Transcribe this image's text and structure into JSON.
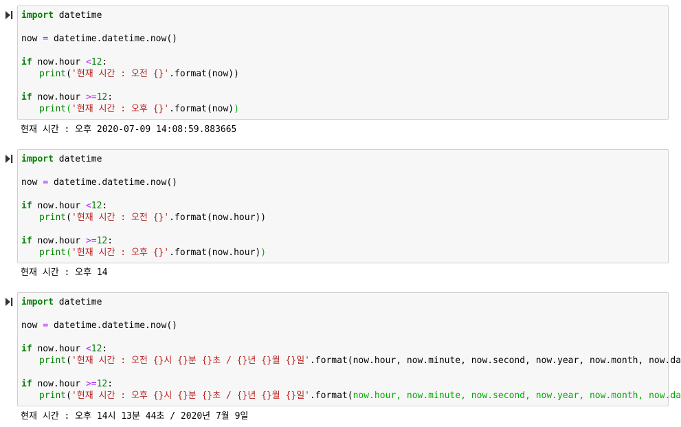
{
  "cells": [
    {
      "run_button": "run-icon",
      "code": {
        "l1": {
          "kw": "import",
          "rest": " datetime"
        },
        "l2": {
          "a": "now ",
          "op": "=",
          "b": " datetime.datetime.now()"
        },
        "l3": {
          "kw": "if",
          "a": " now.hour ",
          "op": "<",
          "num": "12",
          "b": ":"
        },
        "l4": {
          "fn": "print",
          "p": "(",
          "str": "'현재 시간 : 오전 {}'",
          "rest": ".format(now))"
        },
        "l5": {
          "kw": "if",
          "a": " now.hour ",
          "op": ">=",
          "num": "12",
          "b": ":"
        },
        "l6": {
          "fn": "print",
          "p": "(",
          "str": "'현재 시간 : 오후 {}'",
          "rest": ".format(now)",
          "close": ")"
        }
      },
      "output": "현재 시간 : 오후 2020-07-09 14:08:59.883665"
    },
    {
      "run_button": "run-icon",
      "code": {
        "l1": {
          "kw": "import",
          "rest": " datetime"
        },
        "l2": {
          "a": "now ",
          "op": "=",
          "b": " datetime.datetime.now()"
        },
        "l3": {
          "kw": "if",
          "a": " now.hour ",
          "op": "<",
          "num": "12",
          "b": ":"
        },
        "l4": {
          "fn": "print",
          "p": "(",
          "str": "'현재 시간 : 오전 {}'",
          "rest": ".format(now.hour))"
        },
        "l5": {
          "kw": "if",
          "a": " now.hour ",
          "op": ">=",
          "num": "12",
          "b": ":"
        },
        "l6": {
          "fn": "print",
          "p": "(",
          "str": "'현재 시간 : 오후 {}'",
          "rest": ".format(now.hour)",
          "close": ")"
        }
      },
      "output": "현재 시간 : 오후 14"
    },
    {
      "run_button": "run-icon",
      "code": {
        "l1": {
          "kw": "import",
          "rest": " datetime"
        },
        "l2": {
          "a": "now ",
          "op": "=",
          "b": " datetime.datetime.now()"
        },
        "l3": {
          "kw": "if",
          "a": " now.hour ",
          "op": "<",
          "num": "12",
          "b": ":"
        },
        "l4": {
          "fn": "print",
          "p": "(",
          "str": "'현재 시간 : 오전 {}시 {}분 {}초 / {}년 {}월 {}일'",
          "rest": ".format(now.hour, now.minute, now.second, now.year, now.month, now.day))"
        },
        "l5": {
          "kw": "if",
          "a": " now.hour ",
          "op": ">=",
          "num": "12",
          "b": ":"
        },
        "l6": {
          "fn": "print",
          "p": "(",
          "str": "'현재 시간 : 오후 {}시 {}분 {}초 / {}년 {}월 {}일'",
          "rest": ".format(",
          "mid": "now.hour, now.minute, now.second, now.year, now.month, now.day",
          "close": "))"
        }
      },
      "output": "현재 시간 : 오후 14시 13분 44초 / 2020년 7월 9일"
    }
  ]
}
